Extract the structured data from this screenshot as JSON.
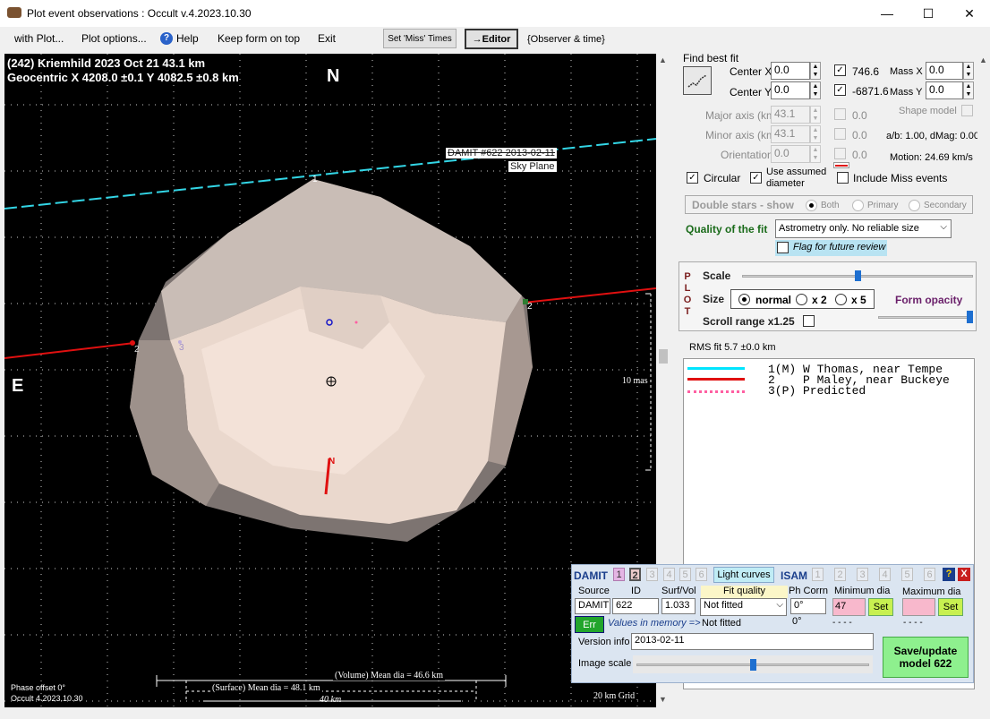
{
  "window": {
    "title": "Plot event observations : Occult v.4.2023.10.30",
    "minimize": "—",
    "maximize": "☐",
    "close": "✕"
  },
  "menu": {
    "with_plot": "with Plot...",
    "plot_options": "Plot options...",
    "help": "Help",
    "keep_on_top": "Keep form on top",
    "exit": "Exit",
    "set_miss": "Set 'Miss' Times",
    "editor": "→Editor",
    "observer_time": "{Observer & time}"
  },
  "plot": {
    "header1": "(242) Kriemhild  2023 Oct 21   43.1 km",
    "header2": "Geocentric  X  4208.0 ±0.1  Y 4082.5 ±0.8 km",
    "north": "N",
    "east": "E",
    "damit_label": "DAMIT #622 2013-02-11",
    "sky_plane": "Sky Plane",
    "chord1": "1",
    "chord2": "2",
    "chord2b": "2",
    "chord3": "3",
    "north_arrow": "N",
    "scale_label": "10 mas",
    "phase_offset": "Phase offset 0°",
    "version": "Occult 4.2023.10.30",
    "volume_dia": "(Volume) Mean dia = 46.6 km",
    "surface_dia": "(Surface) Mean dia = 48.1 km",
    "km40": "40 km",
    "grid": "20 km Grid"
  },
  "fit": {
    "find_best_fit": "Find best fit",
    "center_x_label": "Center X",
    "center_x": "0.0",
    "center_y_label": "Center Y",
    "center_y": "0.0",
    "x_val": "746.6",
    "y_val": "-6871.6",
    "mass_x_label": "Mass X",
    "mass_x": "0.0",
    "mass_y_label": "Mass Y",
    "mass_y": "0.0",
    "major_label": "Major axis (km)",
    "major": "43.1",
    "major2": "0.0",
    "minor_label": "Minor axis (km)",
    "minor": "43.1",
    "minor2": "0.0",
    "orient_label": "Orientation",
    "orient": "0.0",
    "orient2": "0.0",
    "shape_model": "Shape model",
    "ab": "a/b: 1.00, dMag: 0.00",
    "motion": "Motion: 24.69 km/s",
    "circular": "Circular",
    "use_assumed": "Use assumed",
    "diameter": "diameter",
    "include_miss": "Include Miss events",
    "double_stars": "Double stars - show",
    "both": "Both",
    "primary": "Primary",
    "secondary": "Secondary",
    "quality_label": "Quality of the fit",
    "quality_value": "Astrometry only. No reliable size",
    "flag_review": "Flag for future review"
  },
  "plotbox": {
    "plot_letters": [
      "P",
      "L",
      "O",
      "T"
    ],
    "scale": "Scale",
    "size": "Size",
    "normal": "normal",
    "x2": "x 2",
    "x5": "x 5",
    "form_opacity": "Form opacity",
    "scroll_range": "Scroll range x1.25",
    "scale_level": 0.5,
    "opacity_level": 1.0
  },
  "rms": "RMS fit 5.7 ±0.0 km",
  "legend": [
    {
      "text": "1(M) W Thomas, near Tempe",
      "color": "#00e5ff"
    },
    {
      "text": "2    P Maley, near Buckeye",
      "color": "#e01010"
    },
    {
      "text": "3(P) Predicted",
      "color": "#ff5fa2"
    }
  ],
  "damit": {
    "title": "DAMIT",
    "nums": [
      "1",
      "2",
      "3",
      "4",
      "5",
      "6"
    ],
    "light_curves": "Light curves",
    "isam": "ISAM",
    "isam_nums": [
      "1",
      "2",
      "3",
      "4",
      "5",
      "6"
    ],
    "help": "?",
    "close": "X",
    "col_source": "Source",
    "col_id": "ID",
    "col_surf": "Surf/Vol",
    "col_fit": "Fit quality",
    "col_ph": "Ph Corrn",
    "col_min": "Minimum dia",
    "col_max": "Maximum dia",
    "source": "DAMIT",
    "id": "622",
    "surf": "1.033",
    "fit": "Not fitted",
    "fit2": "Not fitted",
    "ph": "0°",
    "ph2": "0°",
    "min": "47",
    "min2": "- - - -",
    "max": "",
    "max2": "- - - -",
    "set": "Set",
    "err": "Err",
    "values_mem": "Values in memory =>",
    "version_label": "Version info",
    "version": "2013-02-11",
    "image_scale": "Image scale",
    "save": "Save/update model 622",
    "image_scale_level": 0.5
  }
}
